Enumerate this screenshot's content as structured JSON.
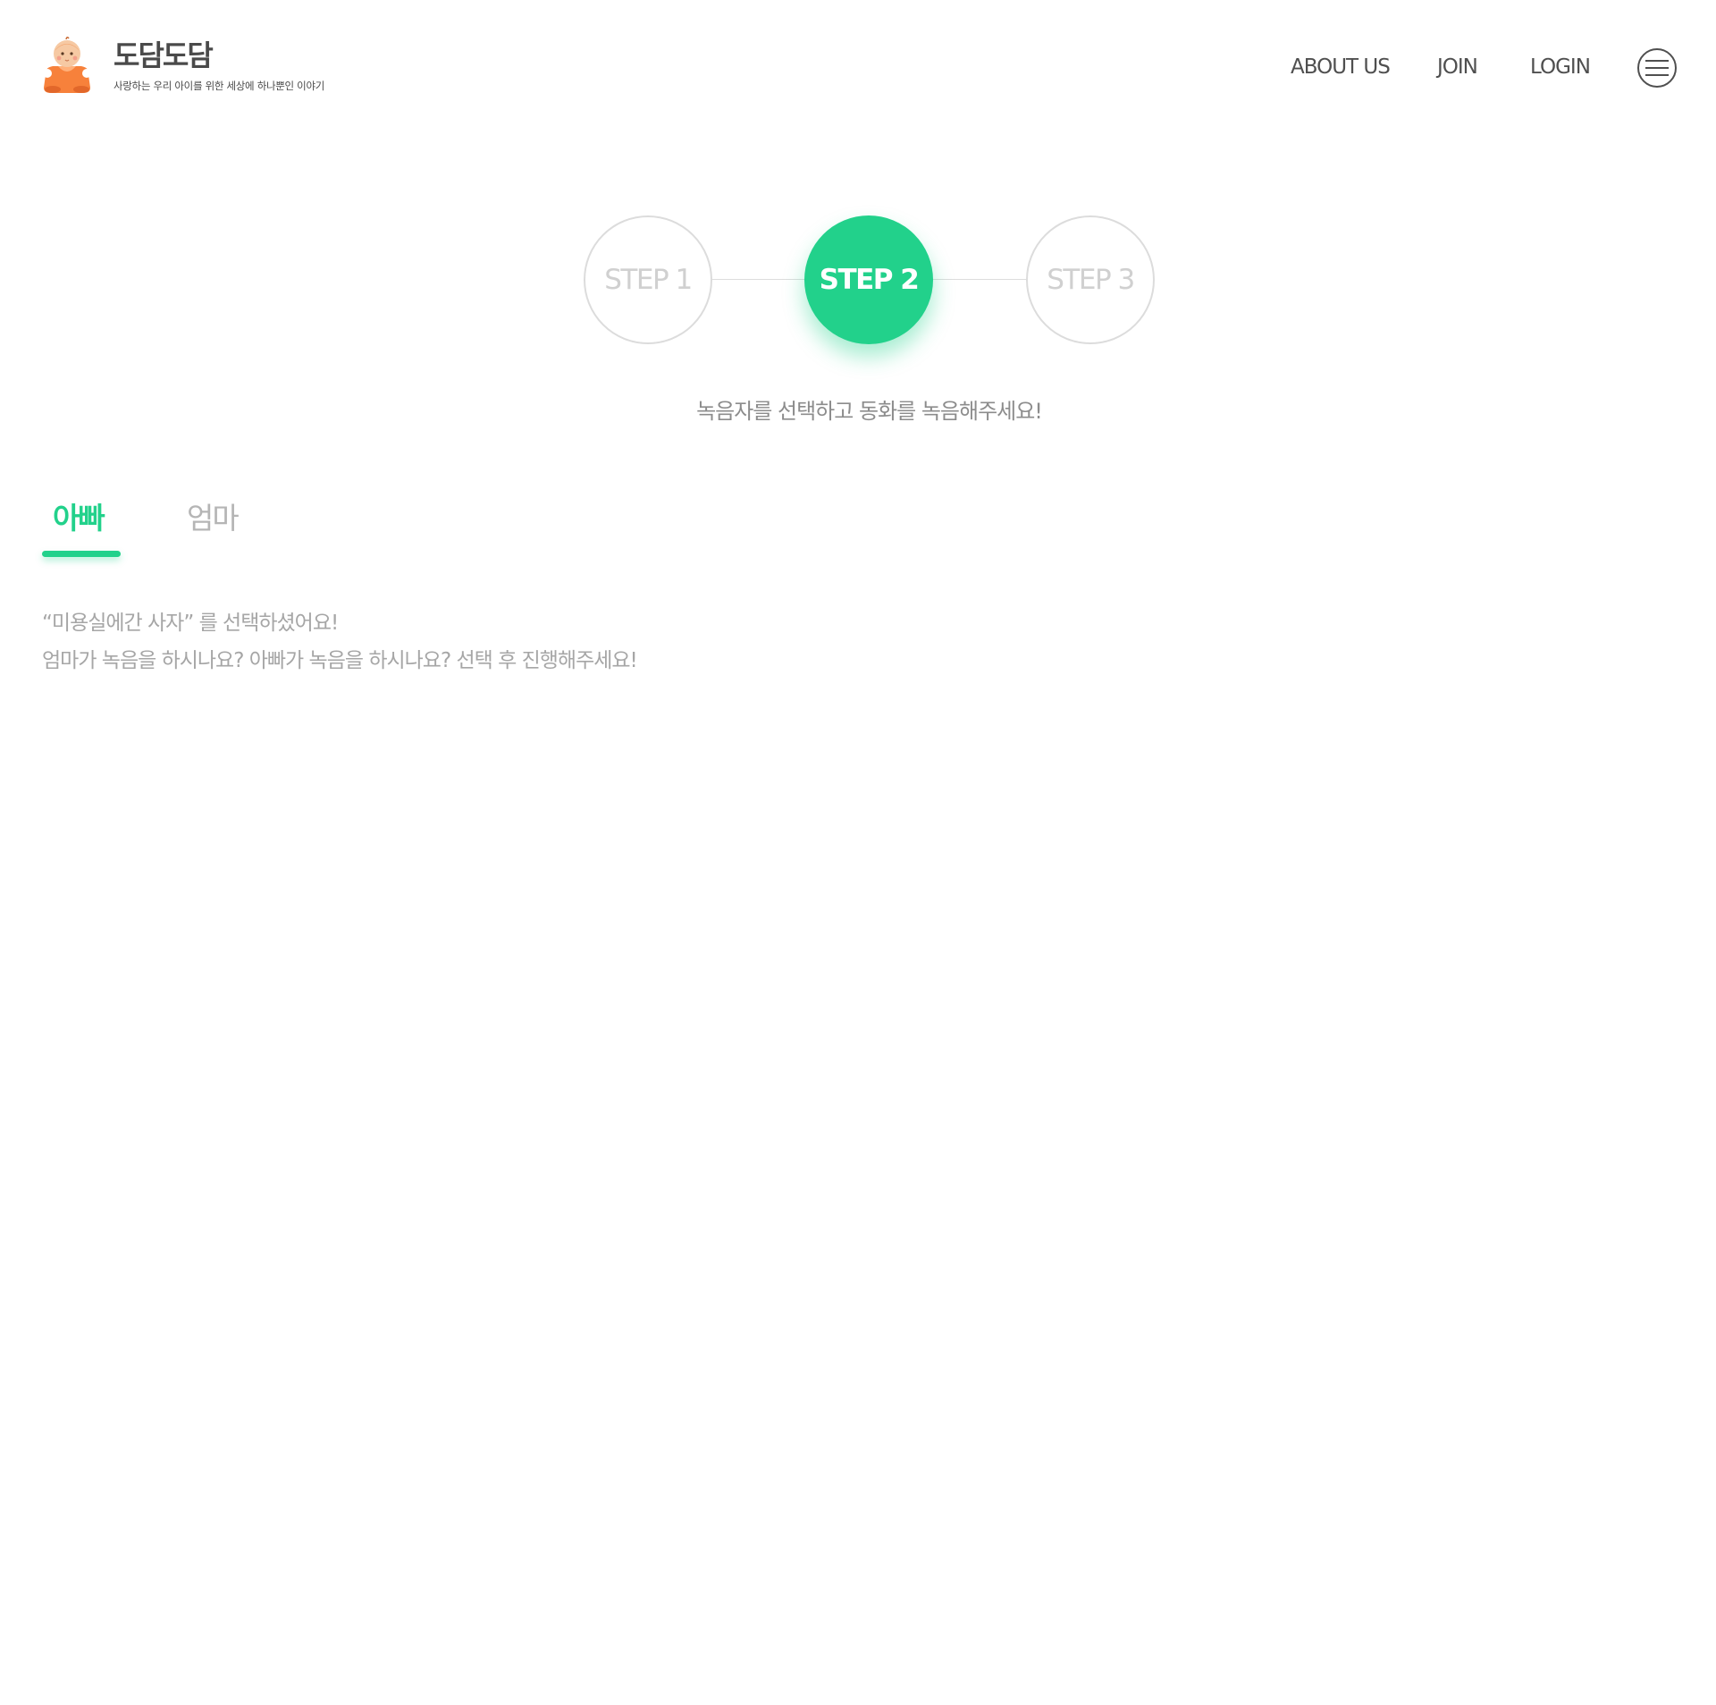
{
  "brand": {
    "name": "도담도담",
    "tagline": "사랑하는 우리 아이를 위한 세상에 하나뿐인 이야기",
    "logo_icon": "baby-mascot-icon"
  },
  "nav": {
    "about": "ABOUT US",
    "join": "JOIN",
    "login": "LOGIN",
    "menu_icon": "hamburger-menu-icon"
  },
  "steps": [
    {
      "label": "STEP 1",
      "state": "inactive"
    },
    {
      "label": "STEP 2",
      "state": "active"
    },
    {
      "label": "STEP 3",
      "state": "inactive"
    }
  ],
  "instruction": "녹음자를 선택하고 동화를 녹음해주세요!",
  "tabs": [
    {
      "label": "아빠",
      "active": true
    },
    {
      "label": "엄마",
      "active": false
    }
  ],
  "description": {
    "line1": "“미용실에간 사자” 를 선택하셨어요!",
    "line2": "엄마가 녹음을 하시나요? 아빠가 녹음을 하시나요? 선택 후 진행해주세요!"
  },
  "colors": {
    "accent": "#22d18b",
    "text_dark": "#4f4f4f",
    "text_muted": "#a6a6a6",
    "step_inactive": "#d0d0d0",
    "logo_orange": "#f7813b"
  }
}
